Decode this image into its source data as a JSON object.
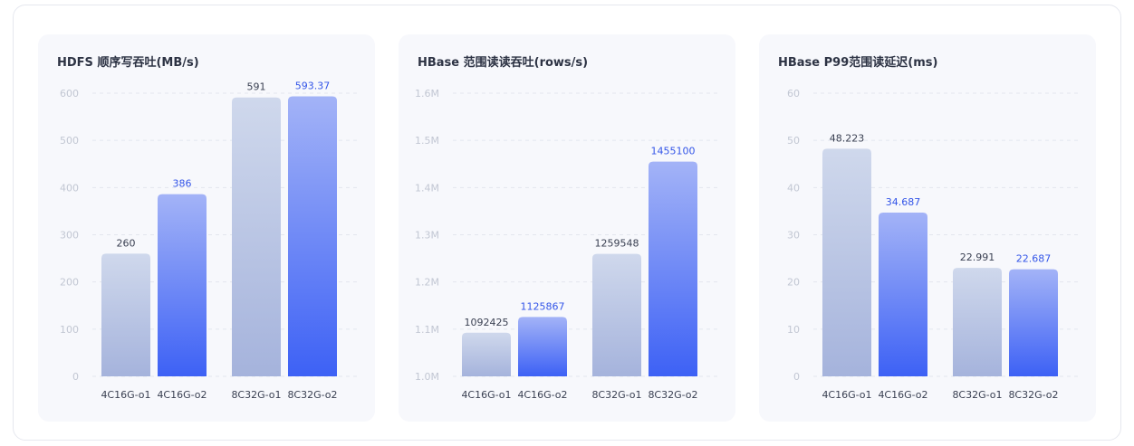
{
  "chart_data": [
    {
      "type": "bar",
      "title": "HDFS 顺序写吞吐(MB/s)",
      "categories": [
        "4C16G-o1",
        "4C16G-o2",
        "8C32G-o1",
        "8C32G-o2"
      ],
      "values": [
        260,
        386,
        591,
        593.37
      ],
      "value_labels": [
        "260",
        "386",
        "591",
        "593.37"
      ],
      "ylim": [
        0,
        600
      ],
      "yticks": [
        "0",
        "100",
        "200",
        "300",
        "400",
        "500",
        "600"
      ],
      "grid": true
    },
    {
      "type": "bar",
      "title": "HBase 范围读读吞吐(rows/s)",
      "categories": [
        "4C16G-o1",
        "4C16G-o2",
        "8C32G-o1",
        "8C32G-o2"
      ],
      "values": [
        1092425,
        1125867,
        1259548,
        1455100
      ],
      "value_labels": [
        "1092425",
        "1125867",
        "1259548",
        "1455100"
      ],
      "ylim": [
        1000000,
        1600000
      ],
      "yticks": [
        "1.0M",
        "1.1M",
        "1.2M",
        "1.3M",
        "1.4M",
        "1.5M",
        "1.6M"
      ],
      "grid": true
    },
    {
      "type": "bar",
      "title": "HBase P99范围读延迟(ms)",
      "categories": [
        "4C16G-o1",
        "4C16G-o2",
        "8C32G-o1",
        "8C32G-o2"
      ],
      "values": [
        48.223,
        34.687,
        22.991,
        22.687
      ],
      "value_labels": [
        "48.223",
        "34.687",
        "22.991",
        "22.687"
      ],
      "ylim": [
        0,
        60
      ],
      "yticks": [
        "0",
        "10",
        "20",
        "30",
        "40",
        "50",
        "60"
      ],
      "grid": true
    }
  ],
  "colors": {
    "baseline_top": "#cfd8ec",
    "baseline_bottom": "#a5b3dc",
    "optimized_top": "#a3b3f7",
    "optimized_bottom": "#3d61f5",
    "baseline_label": "#3a4052",
    "optimized_label": "#3355e8"
  }
}
